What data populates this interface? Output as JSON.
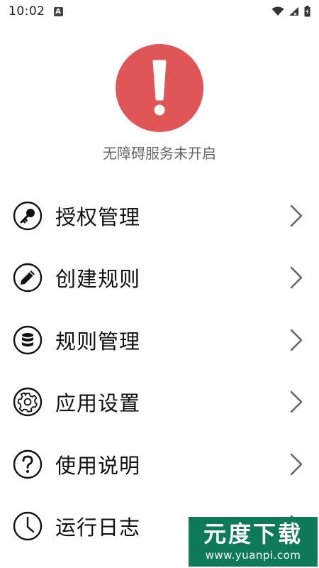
{
  "status_bar": {
    "time": "10:02",
    "notification_icon": "a-letter-icon"
  },
  "alert": {
    "icon": "exclamation-icon",
    "color": "#e05555",
    "message": "无障碍服务未开启"
  },
  "menu": {
    "items": [
      {
        "label": "授权管理",
        "icon": "key-icon"
      },
      {
        "label": "创建规则",
        "icon": "pencil-icon"
      },
      {
        "label": "规则管理",
        "icon": "database-icon"
      },
      {
        "label": "应用设置",
        "icon": "gear-icon"
      },
      {
        "label": "使用说明",
        "icon": "question-icon"
      },
      {
        "label": "运行日志",
        "icon": "clock-icon"
      }
    ]
  },
  "watermark": {
    "title": "元度下载",
    "url": "www.yuanpi.com"
  }
}
